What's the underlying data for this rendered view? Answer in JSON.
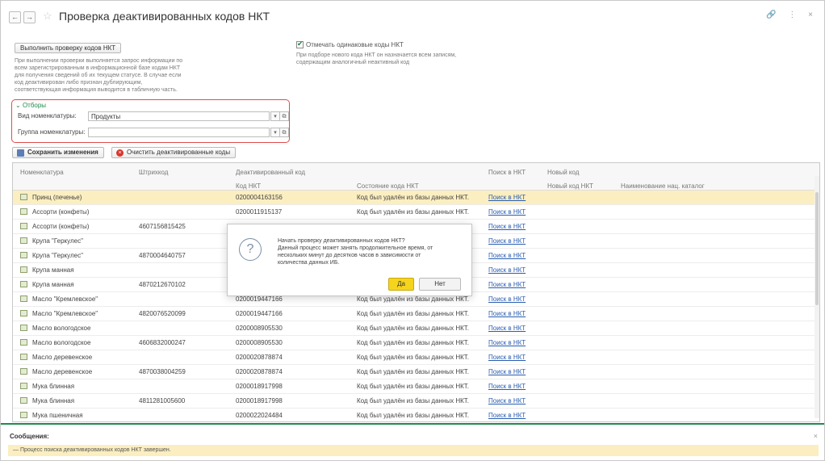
{
  "window": {
    "title": "Проверка деактивированных кодов НКТ",
    "back": "←",
    "forward": "→",
    "tools": "🔗 ⋮ ×"
  },
  "actions": {
    "run_check": "Выполнить проверку кодов НКТ",
    "run_hint": [
      "При выполнении проверки выполняется запрос информации по",
      "всем зарегистрированным в информационной базе кодам НКТ",
      "для получения сведений об их текущем статусе. В случае если",
      "код деактивирован либо признан дублирующим,",
      "соответствующая информация выводится в табличную часть."
    ],
    "mark_same_label": "Отмечать одинаковые коды НКТ",
    "mark_same_checked": true,
    "mark_same_hint": [
      "При подборе нового кода НКТ он назначается всем записям,",
      "содержащим аналогичный неактивный код"
    ]
  },
  "filters": {
    "title": "Отборы",
    "kind_label": "Вид номенклатуры:",
    "kind_value": "Продукты",
    "group_label": "Группа номенклатуры:",
    "group_value": ""
  },
  "toolbar": {
    "save": "Сохранить изменения",
    "clear": "Очистить деактивированные коды"
  },
  "table": {
    "headers": {
      "nomenclature": "Номенклатура",
      "barcode": "Штрихкод",
      "deactivated": "Деактивированный код",
      "code": "Код НКТ",
      "state": "Состояние кода НКТ",
      "search": "Поиск в НКТ",
      "new": "Новый код",
      "new_code": "Новый код НКТ",
      "catalog_name": "Наименование нац. каталог"
    },
    "rows": [
      {
        "name": "Принц (печенье)",
        "barcode": "",
        "code": "0200004163156",
        "state": "Код был удалён из базы данных НКТ.",
        "search": "Поиск в НКТ"
      },
      {
        "name": "Ассорти (конфеты)",
        "barcode": "",
        "code": "0200011915137",
        "state": "Код был удалён из базы данных НКТ.",
        "search": "Поиск в НКТ"
      },
      {
        "name": "Ассорти (конфеты)",
        "barcode": "4607156815425",
        "code": "",
        "state": "",
        "search": "Поиск в НКТ"
      },
      {
        "name": "Крупа \"Геркулес\"",
        "barcode": "",
        "code": "",
        "state": "",
        "search": "Поиск в НКТ"
      },
      {
        "name": "Крупа \"Геркулес\"",
        "barcode": "4870004640757",
        "code": "",
        "state": "",
        "search": "Поиск в НКТ"
      },
      {
        "name": "Крупа манная",
        "barcode": "",
        "code": "",
        "state": "",
        "search": "Поиск в НКТ"
      },
      {
        "name": "Крупа манная",
        "barcode": "4870212670102",
        "code": "",
        "state": "",
        "search": "Поиск в НКТ"
      },
      {
        "name": "Масло \"Кремлевское\"",
        "barcode": "",
        "code": "0200019447166",
        "state": "Код был удалён из базы данных НКТ.",
        "search": "Поиск в НКТ"
      },
      {
        "name": "Масло \"Кремлевское\"",
        "barcode": "4820076520099",
        "code": "0200019447166",
        "state": "Код был удалён из базы данных НКТ.",
        "search": "Поиск в НКТ"
      },
      {
        "name": "Масло вологодское",
        "barcode": "",
        "code": "0200008905530",
        "state": "Код был удалён из базы данных НКТ.",
        "search": "Поиск в НКТ"
      },
      {
        "name": "Масло вологодское",
        "barcode": "4606832000247",
        "code": "0200008905530",
        "state": "Код был удалён из базы данных НКТ.",
        "search": "Поиск в НКТ"
      },
      {
        "name": "Масло деревенское",
        "barcode": "",
        "code": "0200020878874",
        "state": "Код был удалён из базы данных НКТ.",
        "search": "Поиск в НКТ"
      },
      {
        "name": "Масло деревенское",
        "barcode": "4870038004259",
        "code": "0200020878874",
        "state": "Код был удалён из базы данных НКТ.",
        "search": "Поиск в НКТ"
      },
      {
        "name": "Мука блинная",
        "barcode": "",
        "code": "0200018917998",
        "state": "Код был удалён из базы данных НКТ.",
        "search": "Поиск в НКТ"
      },
      {
        "name": "Мука блинная",
        "barcode": "4811281005600",
        "code": "0200018917998",
        "state": "Код был удалён из базы данных НКТ.",
        "search": "Поиск в НКТ"
      },
      {
        "name": "Мука пшеничная",
        "barcode": "",
        "code": "0200022024484",
        "state": "Код был удалён из базы данных НКТ.",
        "search": "Поиск в НКТ"
      }
    ]
  },
  "dialog": {
    "line1": "Начать проверку деактивированных кодов НКТ?",
    "line2": "Данный процесс может занять продолжительное время, от",
    "line3": "нескольких минут до десятков часов в зависимости от",
    "line4": "количества данных ИБ.",
    "yes": "Да",
    "no": "Нет"
  },
  "messages": {
    "title": "Сообщения:",
    "text": "— Процесс поиска деактивированных кодов НКТ завершен."
  },
  "colors": {
    "accent_green": "#1f8a4c",
    "filter_border": "#e24b4b",
    "selected_row": "#fbeec0",
    "yes_button": "#f5d41d",
    "link": "#2a5db0"
  }
}
